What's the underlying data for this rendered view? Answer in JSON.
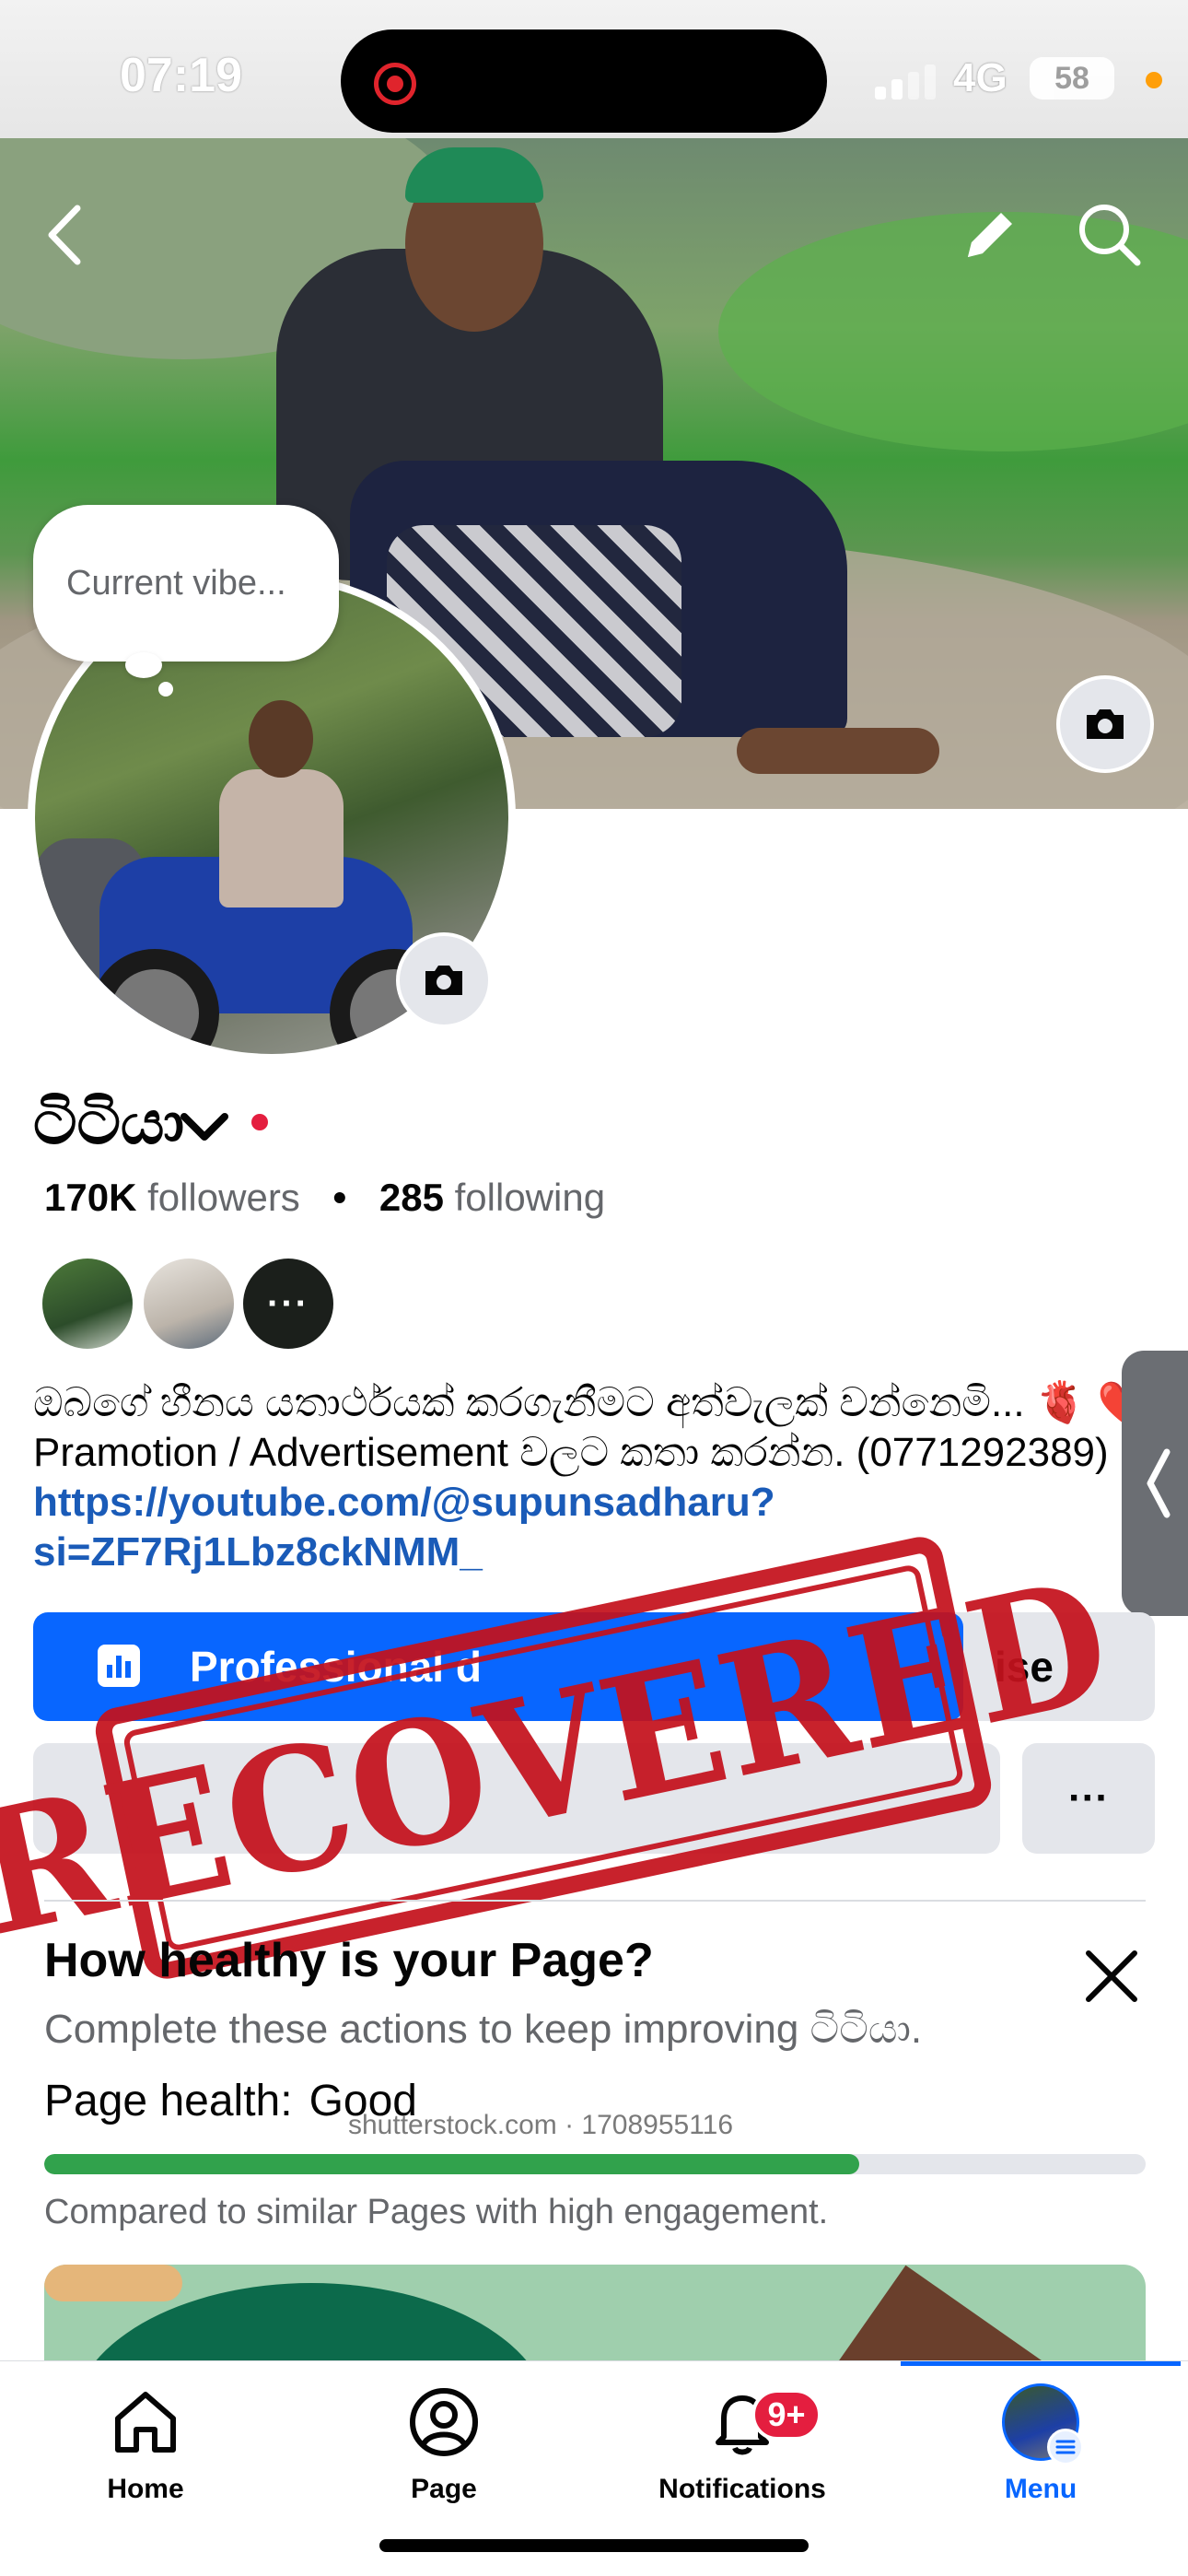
{
  "status_bar": {
    "time": "07:19",
    "network": "4G",
    "battery": "58"
  },
  "profile": {
    "vibe_placeholder": "Current vibe...",
    "name": "ටිටියා",
    "followers_count": "170K",
    "followers_label": "followers",
    "separator": "•",
    "following_count": "285",
    "following_label": "following",
    "more_mutuals": "···"
  },
  "bio": {
    "line1": "ඔබගේ හීනය යතාර්ථයක් කරගැනීමට අත්වැලක් වන්නෙමි...",
    "line1_emoji": "🫀 ❤️",
    "line2": "Pramotion / Advertisement වලට කතා කරන්න. (0771292389)",
    "link_line1": "https://youtube.com/@supunsadharu?",
    "link_line2": "si=ZF7Rj1Lbz8ckNMM_"
  },
  "actions": {
    "professional_dashboard": "Professional d",
    "advertise": "ise",
    "more": "···"
  },
  "stamp_text": "RECOVERED",
  "page_health": {
    "title": "How healthy is your Page?",
    "subtitle": "Complete these actions to keep improving ටිටියා.",
    "label": "Page health:",
    "value": "Good",
    "progress_fraction": 0.74,
    "compare_text": "Compared to similar Pages with high engagement."
  },
  "watermark": "shutterstock.com · 1708955116",
  "bottom_nav": {
    "home": "Home",
    "page": "Page",
    "notifications": "Notifications",
    "notifications_badge": "9+",
    "menu": "Menu"
  },
  "colors": {
    "accent": "#0866ff",
    "health_good": "#31a24c",
    "stamp_red": "#c4121d",
    "badge_red": "#e41e3f"
  }
}
